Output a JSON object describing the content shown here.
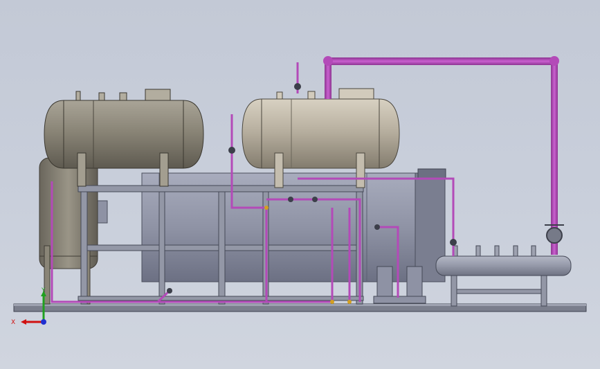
{
  "viewport": {
    "background_top": "#c3c9d6",
    "background_bottom": "#d0d5df"
  },
  "colors": {
    "pipe": "#b34ab8",
    "pipe_dark": "#7d2a82",
    "steel": "#8e92a2",
    "steel_dark": "#5a5e6c",
    "tank_left": "#8a8577",
    "tank_right": "#b8b0a0",
    "main_body": "#8f93a5"
  },
  "triad": {
    "x_label": "X",
    "y_label": "Y",
    "x_color": "#d01010",
    "y_color": "#20a020",
    "z_color": "#2030d0"
  },
  "components": [
    {
      "name": "left-horizontal-tank",
      "icon": "horizontal-vessel"
    },
    {
      "name": "right-horizontal-tank",
      "icon": "horizontal-vessel"
    },
    {
      "name": "left-vertical-tank",
      "icon": "vertical-vessel"
    },
    {
      "name": "main-boiler-body",
      "icon": "cylinder"
    },
    {
      "name": "steam-header",
      "icon": "manifold"
    },
    {
      "name": "piping-network",
      "icon": "pipe"
    },
    {
      "name": "skid-base-frame",
      "icon": "frame"
    }
  ]
}
